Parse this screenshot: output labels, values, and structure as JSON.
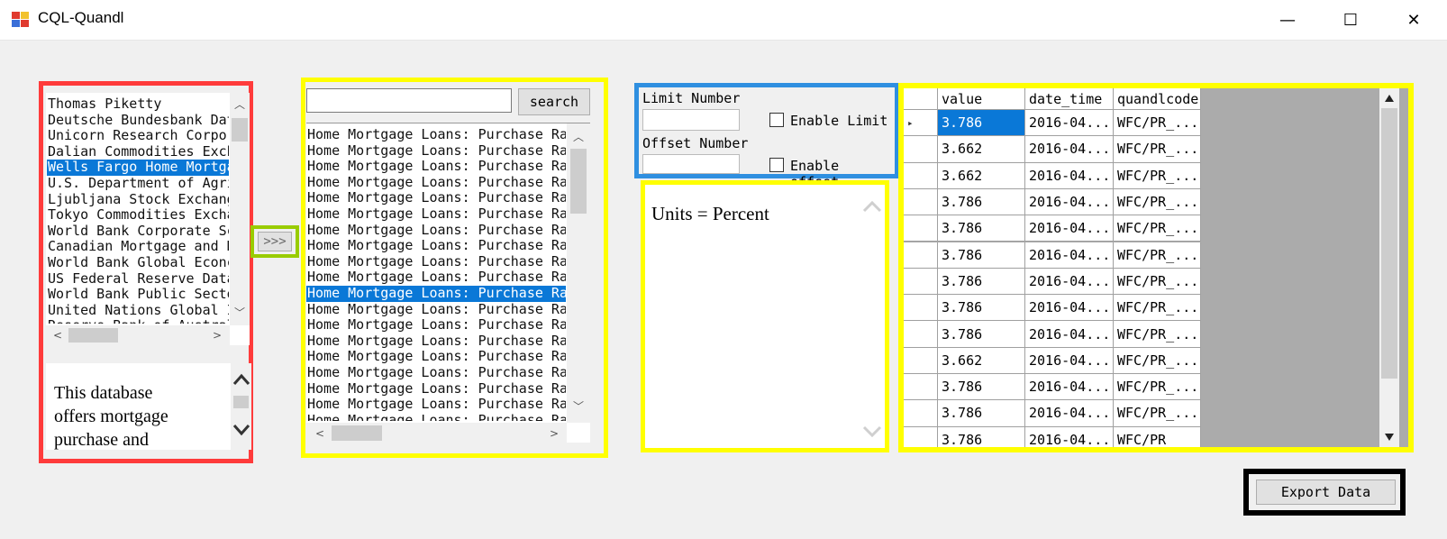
{
  "window": {
    "title": "CQL-Quandl",
    "minimize_glyph": "—",
    "maximize_glyph": "☐",
    "close_glyph": "✕"
  },
  "colors": {
    "red_frame": "#ff3b3b",
    "yellow_frame": "#ffff00",
    "green_frame": "#99cc00",
    "blue_frame": "#2f8fe0",
    "black_frame": "#000000",
    "selection": "#0a78d7"
  },
  "database_list": {
    "items": [
      "Thomas Piketty",
      "Deutsche Bundesbank Dat",
      "Unicorn Research Corpor",
      "Dalian Commodities Exch",
      "Wells Fargo Home Mortga",
      "U.S. Department of Agri",
      "Ljubljana Stock Exchang",
      "Tokyo Commodities Excha",
      "World Bank Corporate Sc",
      "Canadian Mortgage and H",
      "World Bank Global Econc",
      "US Federal Reserve Data",
      "World Bank Public Secto",
      "United Nations Global I",
      "Reserve Bank of Austral"
    ],
    "selected_index": 4
  },
  "description": {
    "text_lines": [
      "This database",
      "offers mortgage",
      "purchase and"
    ]
  },
  "transfer_button": {
    "label": ">>>"
  },
  "search": {
    "input_value": "",
    "button_label": "search"
  },
  "dataset_list": {
    "item_text": "Home Mortgage Loans: Purchase Rat",
    "count": 19,
    "selected_index": 10
  },
  "limits": {
    "limit_label": "Limit Number",
    "limit_value": "",
    "enable_limit_label": "Enable Limit",
    "offset_label": "Offset Number",
    "offset_value": "",
    "enable_offset_label": "Enable offset"
  },
  "units": {
    "text": "Units = Percent"
  },
  "grid": {
    "columns": [
      "value",
      "date_time",
      "quandlcode"
    ],
    "rows": [
      [
        "3.786",
        "2016-04...",
        "WFC/PR_..."
      ],
      [
        "3.662",
        "2016-04...",
        "WFC/PR_..."
      ],
      [
        "3.662",
        "2016-04...",
        "WFC/PR_..."
      ],
      [
        "3.786",
        "2016-04...",
        "WFC/PR_..."
      ],
      [
        "3.786",
        "2016-04...",
        "WFC/PR_..."
      ],
      [
        "3.786",
        "2016-04...",
        "WFC/PR_..."
      ],
      [
        "3.786",
        "2016-04...",
        "WFC/PR_..."
      ],
      [
        "3.786",
        "2016-04...",
        "WFC/PR_..."
      ],
      [
        "3.786",
        "2016-04...",
        "WFC/PR_..."
      ],
      [
        "3.662",
        "2016-04...",
        "WFC/PR_..."
      ],
      [
        "3.786",
        "2016-04...",
        "WFC/PR_..."
      ],
      [
        "3.786",
        "2016-04...",
        "WFC/PR_..."
      ],
      [
        "3.786",
        "2016-04...",
        "WFC/PR_"
      ]
    ],
    "current_row_glyph": "▸"
  },
  "export": {
    "button_label": "Export Data"
  }
}
